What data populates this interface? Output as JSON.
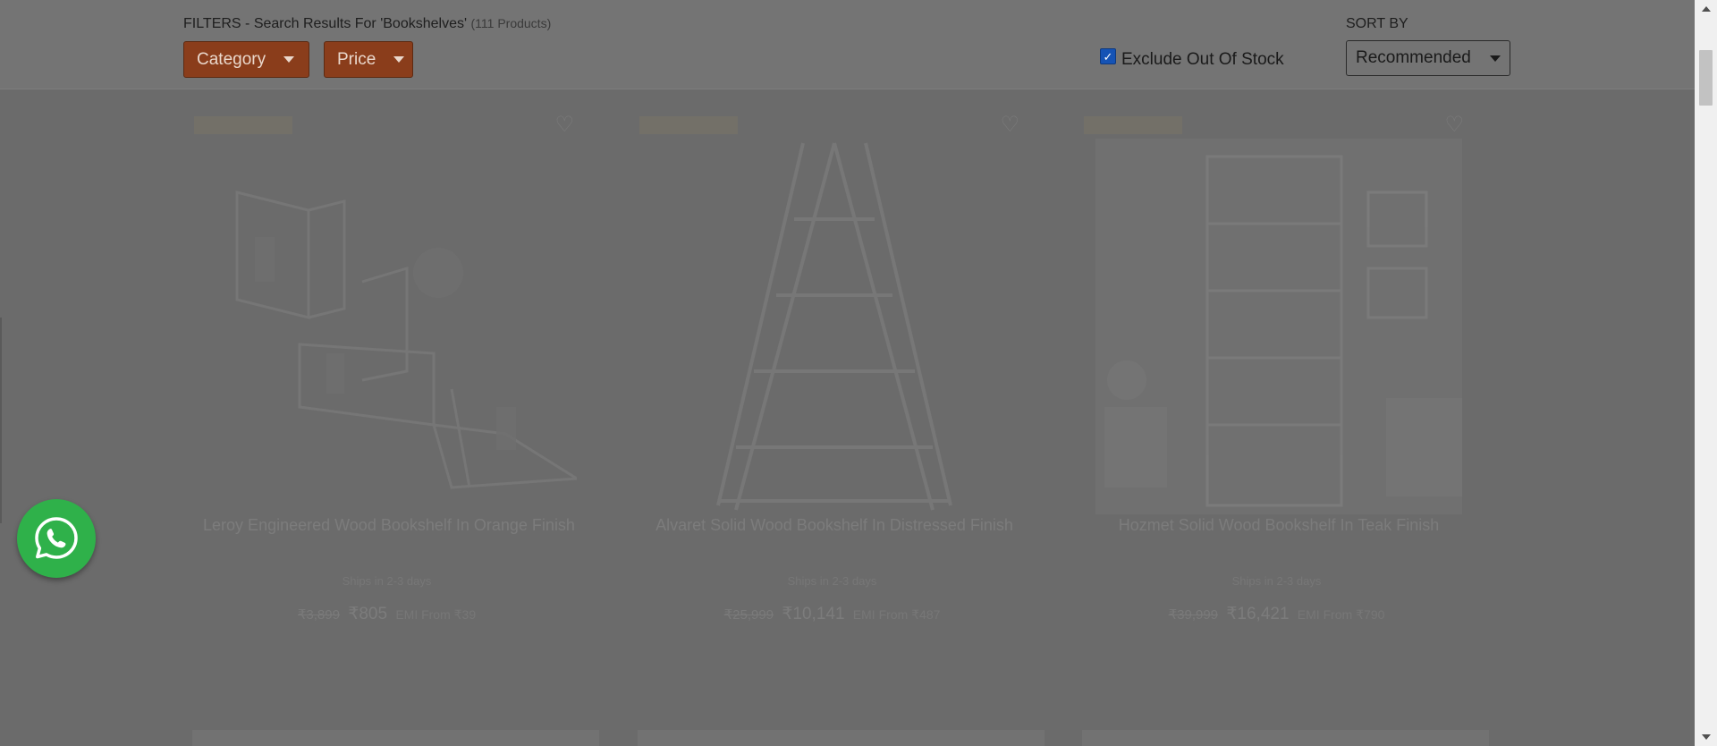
{
  "filters": {
    "title": "FILTERS - Search Results For 'Bookshelves'",
    "count": "(111 Products)",
    "category_label": "Category",
    "price_label": "Price",
    "exclude_label": "Exclude Out Of Stock",
    "exclude_checked": true
  },
  "sort": {
    "label": "SORT BY",
    "value": "Recommended"
  },
  "products": [
    {
      "name": "Leroy Engineered Wood Bookshelf In Orange Finish",
      "mrp": "₹3,899",
      "price": "₹805",
      "emi": "EMI From ₹39"
    },
    {
      "name": "Alvaret Solid Wood Bookshelf In Distressed Finish",
      "mrp": "₹25,999",
      "price": "₹10,141",
      "emi": "EMI From ₹487"
    },
    {
      "name": "Hozmet Solid Wood Bookshelf In Teak Finish",
      "mrp": "₹39,999",
      "price": "₹16,421",
      "emi": "EMI From ₹790"
    }
  ],
  "delivery_text": "Ships in 2-3 days",
  "icons": {
    "whatsapp": "whatsapp-icon",
    "wishlist": "heart-icon",
    "dropdown": "chevron-down-icon"
  },
  "colors": {
    "button_bg": "#8a3d1b",
    "checkbox": "#1553b5",
    "whatsapp": "#2fb14a",
    "overlay": "#6b6b6b"
  }
}
